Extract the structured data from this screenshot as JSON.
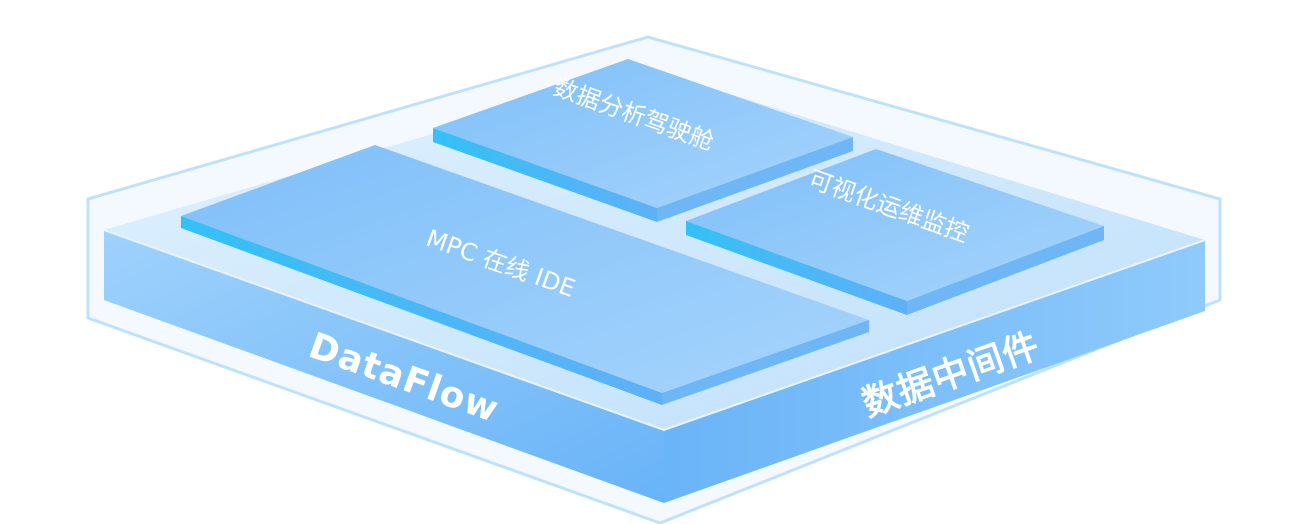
{
  "diagram": {
    "base": {
      "left_label": "DataFlow",
      "right_label": "数据中间件"
    },
    "modules": [
      {
        "id": "mpc-ide",
        "label": "MPC 在线 IDE"
      },
      {
        "id": "cockpit",
        "label": "数据分析驾驶舱"
      },
      {
        "id": "monitor",
        "label": "可视化运维监控"
      }
    ],
    "colors": {
      "outline": "#bfe2fb",
      "base_top": "#cfe9fd",
      "base_front_left": "#7cc0fb",
      "base_front_right": "#5eaef8",
      "tile_top": "#93c9fb",
      "tile_edge": "#3fbaf7"
    }
  }
}
